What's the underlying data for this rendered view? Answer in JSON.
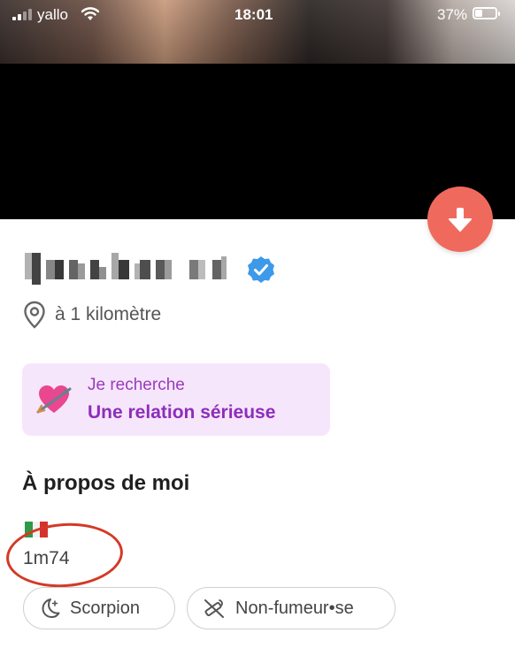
{
  "status_bar": {
    "carrier": "yallo",
    "time": "18:01",
    "battery": "37%",
    "battery_level": 0.37
  },
  "profile": {
    "name_pixelated": "Jessica 24",
    "verified_icon": "verified-badge-icon",
    "distance": "à 1 kilomètre",
    "looking_for": {
      "label": "Je recherche",
      "value": "Une relation sérieuse",
      "emoji": "heart-with-arrow"
    },
    "about": {
      "title": "À propos de moi",
      "flag": "italy-flag",
      "height": "1m74"
    },
    "tags": [
      {
        "icon": "moon-stars-icon",
        "label": "Scorpion"
      },
      {
        "icon": "no-smoking-icon",
        "label": "Non-fumeur•se"
      }
    ]
  },
  "colors": {
    "accent_button": "#ef6a5d",
    "looking_bg": "#f6e6fb",
    "looking_text": "#8e2dbb",
    "verified_blue": "#3d9ae8",
    "annotation_red": "#d33a26"
  }
}
